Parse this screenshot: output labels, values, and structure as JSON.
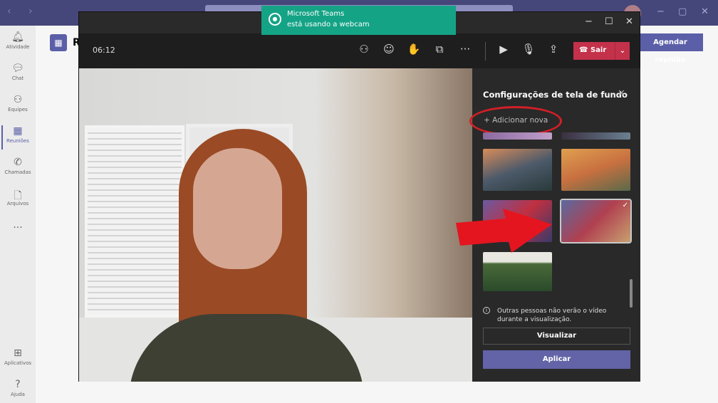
{
  "app": {
    "nav": "‹ ›",
    "window_controls": [
      "−",
      "▢",
      "✕"
    ]
  },
  "sidebar": {
    "items": [
      {
        "label": "Atividade",
        "icon": "bell-icon",
        "glyph": "🔔︎"
      },
      {
        "label": "Chat",
        "icon": "chat-icon",
        "glyph": "💬︎"
      },
      {
        "label": "Equipes",
        "icon": "teams-icon",
        "glyph": "⚇"
      },
      {
        "label": "Reuniões",
        "icon": "calendar-icon",
        "glyph": "▦",
        "active": true
      },
      {
        "label": "Chamadas",
        "icon": "phone-icon",
        "glyph": "✆"
      },
      {
        "label": "Arquivos",
        "icon": "file-icon",
        "glyph": "🗋"
      },
      {
        "label": "",
        "icon": "more-icon",
        "glyph": "···"
      },
      {
        "label": "Aplicativos",
        "icon": "apps-icon",
        "glyph": "⊞"
      },
      {
        "label": "Ajuda",
        "icon": "help-icon",
        "glyph": "?"
      }
    ]
  },
  "main": {
    "schedule_button": "Agendar reunião",
    "header_initial": "R"
  },
  "toast": {
    "title": "Microsoft Teams",
    "message": "está usando a webcam"
  },
  "meeting": {
    "timer": "06:12",
    "window_controls": [
      "−",
      "☐",
      "✕"
    ],
    "toolbar": [
      "⚇",
      "☺",
      "✋",
      "⧉",
      "···",
      "▶",
      "🎙︎",
      "⇪"
    ],
    "leave_label": "Sair",
    "leave_icon": "☎",
    "dropdown": "⌄"
  },
  "panel": {
    "title": "Configurações de tela de fundo",
    "close": "✕",
    "add_new": "+  Adicionar nova",
    "info_icon": "i",
    "info": "Outras pessoas não verão o vídeo durante a visualização.",
    "preview_button": "Visualizar",
    "apply_button": "Aplicar",
    "selected_check": "✓"
  },
  "colors": {
    "accent": "#6264a7",
    "leave": "#c4314b",
    "toast": "#15a386",
    "annotation": "#d21f26"
  }
}
